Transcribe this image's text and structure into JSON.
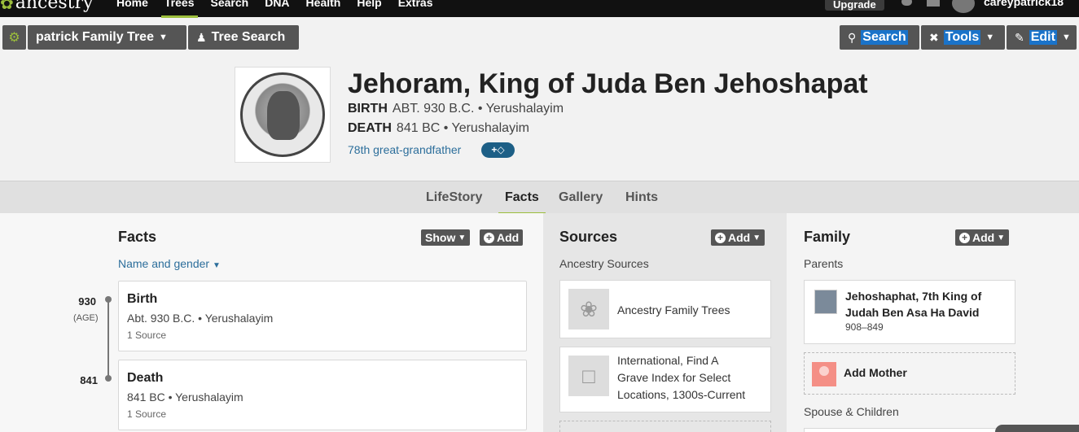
{
  "nav": {
    "logo": "ancestry",
    "links": [
      "Home",
      "Trees",
      "Search",
      "DNA",
      "Health",
      "Help",
      "Extras"
    ],
    "active": "Trees",
    "upgrade": "Upgrade",
    "username": "careypatrick18"
  },
  "toolbar": {
    "family_tree": "patrick Family Tree",
    "tree_search": "Tree Search",
    "search": "Search",
    "tools": "Tools",
    "edit": "Edit"
  },
  "person": {
    "name": "Jehoram, King of Juda Ben Jehoshapat",
    "birth_label": "BIRTH",
    "birth_value": "ABT. 930 B.C. • Yerushalayim",
    "death_label": "DEATH",
    "death_value": "841 BC • Yerushalayim",
    "relationship": "78th great-grandfather",
    "portrait_icon": "coin-portrait"
  },
  "tabs": [
    "LifeStory",
    "Facts",
    "Gallery",
    "Hints"
  ],
  "active_tab": "Facts",
  "facts": {
    "title": "Facts",
    "show_btn": "Show",
    "add_btn": "Add",
    "name_gender_link": "Name and gender",
    "items": [
      {
        "year": "930",
        "age": "(AGE)",
        "title": "Birth",
        "detail": "Abt. 930 B.C. • Yerushalayim",
        "sources": "1 Source"
      },
      {
        "year": "841",
        "title": "Death",
        "detail": "841 BC • Yerushalayim",
        "sources": "1 Source"
      }
    ]
  },
  "sources": {
    "title": "Sources",
    "add_btn": "Add",
    "subtitle": "Ancestry Sources",
    "items": [
      {
        "text": "Ancestry Family Trees",
        "icon": "leaf-icon"
      },
      {
        "line1": "International, Find A",
        "line2": "Grave Index for Select",
        "line3": "Locations, 1300s-Current",
        "icon": "document-icon"
      }
    ]
  },
  "family": {
    "title": "Family",
    "add_btn": "Add",
    "parents_label": "Parents",
    "father_line1": "Jehoshaphat, 7th King of",
    "father_line2": "Judah Ben Asa Ha David",
    "father_dates": "908–849",
    "add_mother": "Add Mother",
    "spouse_label": "Spouse & Children"
  },
  "colors": {
    "accent": "#9cbe3c",
    "button": "#555555",
    "link": "#2c6e9b",
    "highlight": "#1a73c9"
  }
}
